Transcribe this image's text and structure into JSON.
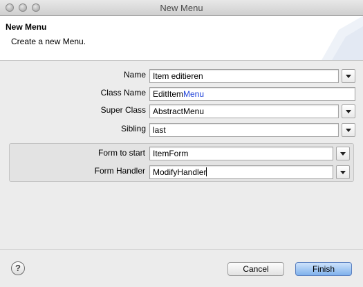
{
  "window": {
    "title": "New Menu"
  },
  "banner": {
    "title": "New Menu",
    "message": "Create a new Menu."
  },
  "form": {
    "name": {
      "label": "Name",
      "value": "Item editieren"
    },
    "class_name": {
      "label": "Class Name",
      "value_prefix": "EditItem",
      "value_suffix": "Menu"
    },
    "super_class": {
      "label": "Super Class",
      "value": "AbstractMenu"
    },
    "sibling": {
      "label": "Sibling",
      "value": "last"
    },
    "form_to_start": {
      "label": "Form to start",
      "value": "ItemForm"
    },
    "form_handler": {
      "label": "Form Handler",
      "value": "ModifyHandler"
    }
  },
  "buttons": {
    "help": "?",
    "cancel": "Cancel",
    "finish": "Finish"
  },
  "colors": {
    "accent_blue": "#1a3ed8",
    "primary_button": "#7fb1ec"
  },
  "icons": {
    "help": "help-icon",
    "dropdown": "chevron-down-icon"
  }
}
